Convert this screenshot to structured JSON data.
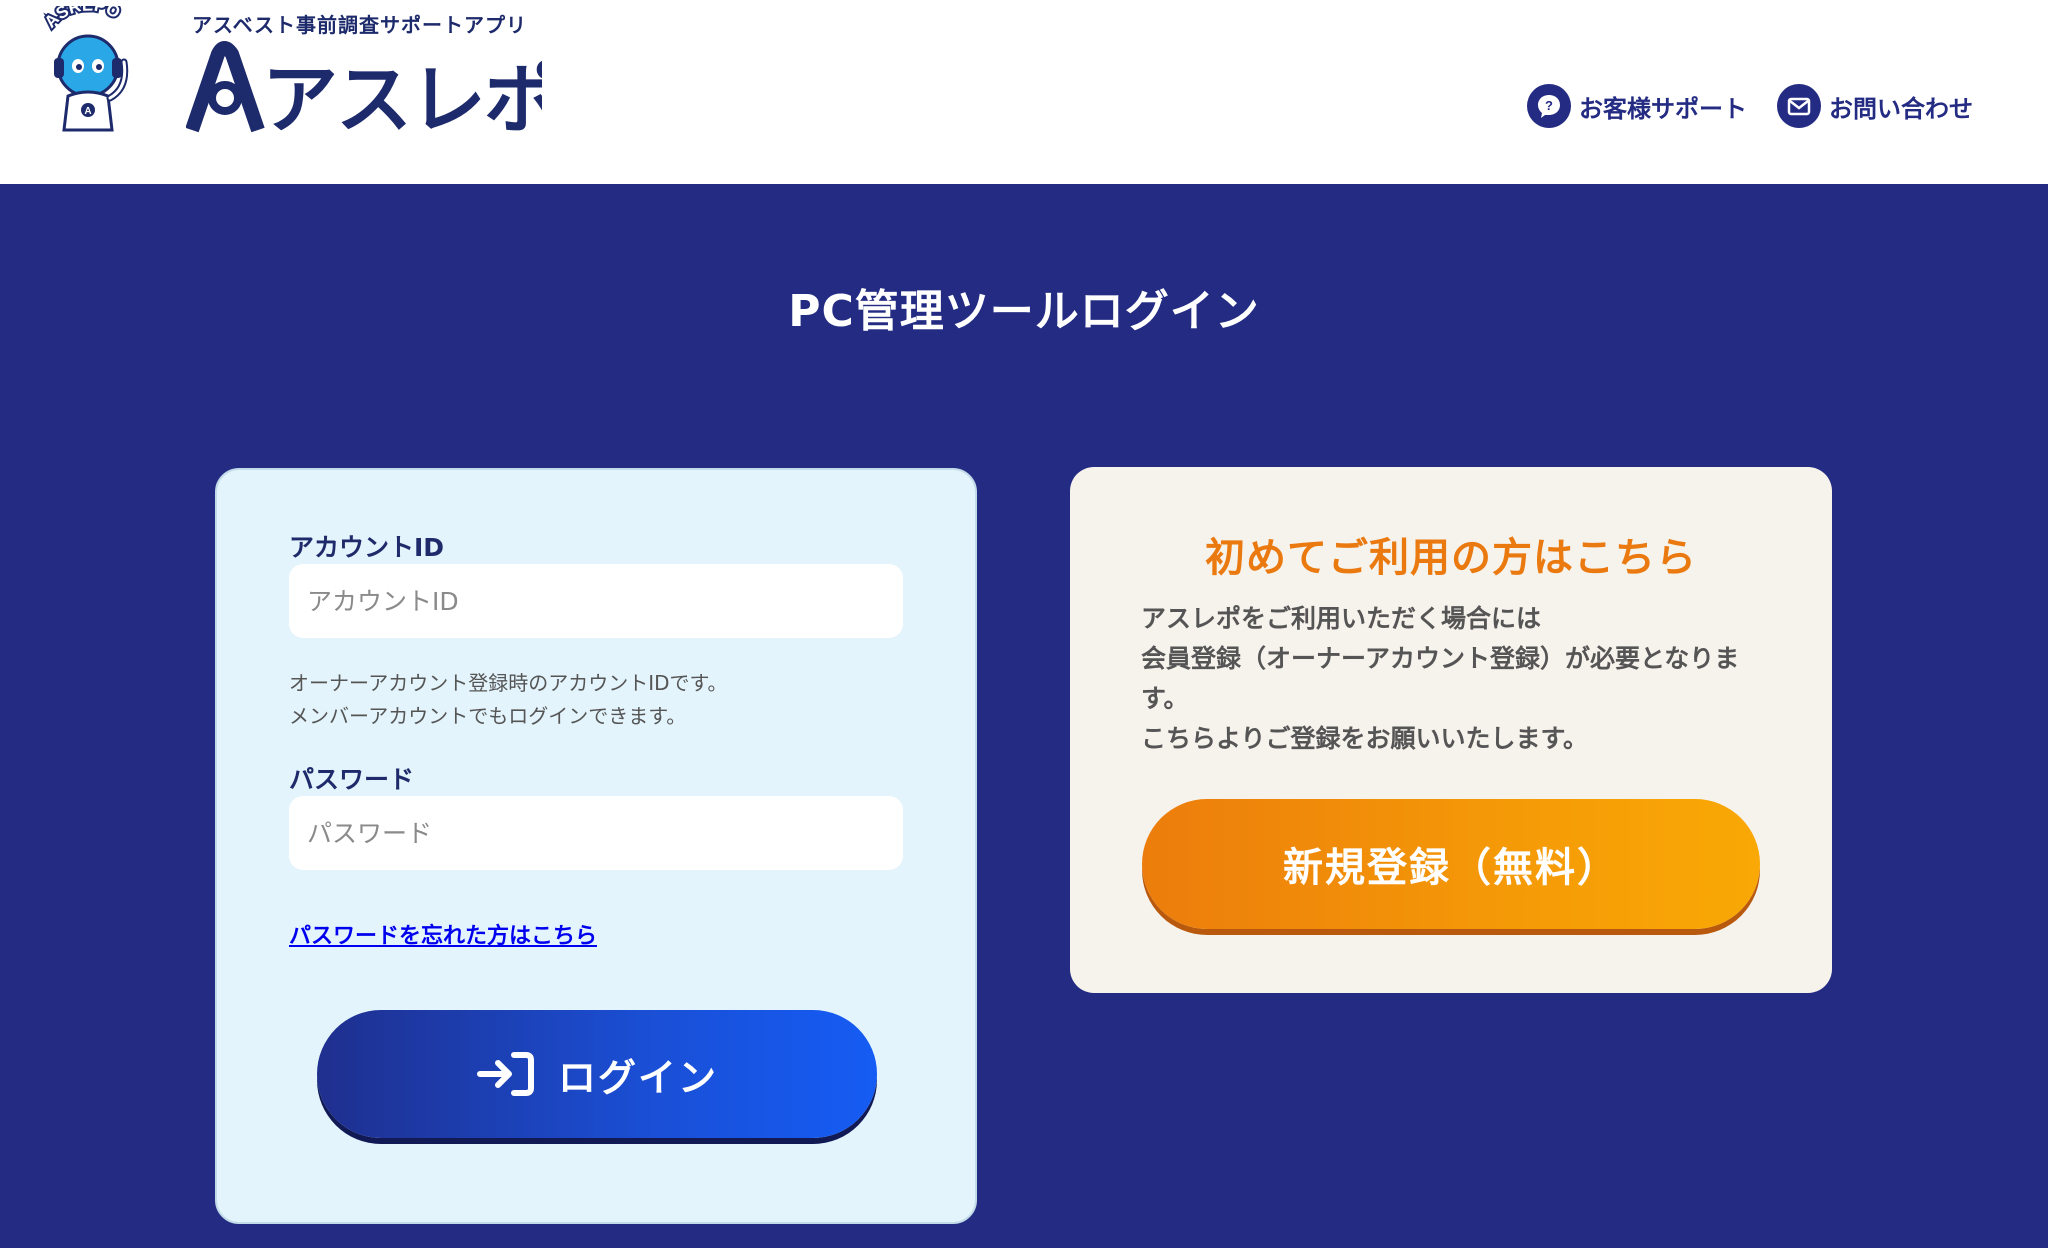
{
  "header": {
    "tagline": "アスベスト事前調査サポートアプリ",
    "mascot_text": "ASREPO",
    "logo_text": "アスレポ",
    "support_link": "お客様サポート",
    "contact_link": "お問い合わせ"
  },
  "page_title": "PC管理ツールログイン",
  "login": {
    "account_id_label": "アカウントID",
    "account_id_placeholder": "アカウントID",
    "account_id_value": "",
    "hint_line1": "オーナーアカウント登録時のアカウントIDです。",
    "hint_line2": "メンバーアカウントでもログインできます。",
    "password_label": "パスワード",
    "password_placeholder": "パスワード",
    "password_value": "",
    "forgot_link": "パスワードを忘れた方はこちら",
    "login_button": "ログイン"
  },
  "register": {
    "title": "初めてご利用の方はこちら",
    "body_line1": "アスレポをご利用いただく場合には",
    "body_line2": "会員登録（オーナーアカウント登録）が必要となりま",
    "body_line3": "す。",
    "body_line4": "こちらよりご登録をお願いいたします。",
    "button": "新規登録（無料）"
  },
  "colors": {
    "page_background": "#242b83",
    "brand_navy": "#242b83",
    "login_card_bg": "#e3f4fc",
    "register_card_bg": "#f6f2ec",
    "accent_orange": "#ea7a10",
    "login_button_blue": "#155cf4"
  },
  "icons": {
    "support": "question-bubble-icon",
    "contact": "envelope-icon",
    "login": "login-arrow-icon"
  }
}
